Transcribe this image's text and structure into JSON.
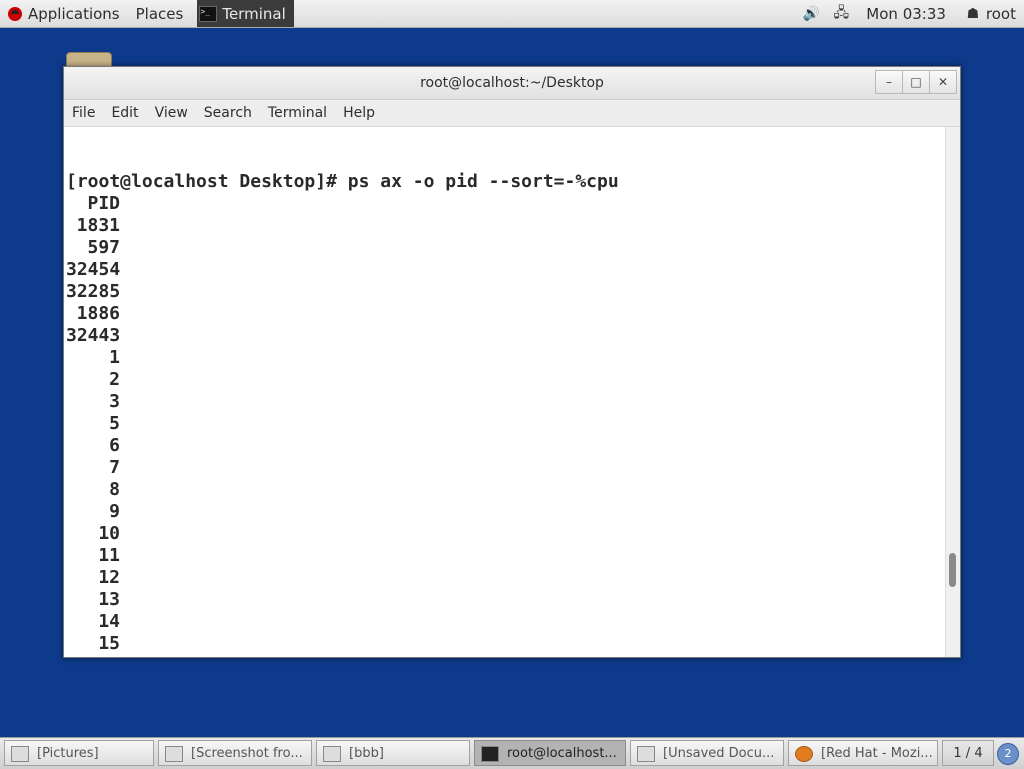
{
  "top_panel": {
    "applications": "Applications",
    "places": "Places",
    "active_app": "Terminal",
    "clock": "Mon 03:33",
    "user": "root"
  },
  "window": {
    "title": "root@localhost:~/Desktop",
    "menu": [
      "File",
      "Edit",
      "View",
      "Search",
      "Terminal",
      "Help"
    ]
  },
  "terminal": {
    "command_line": "[root@localhost Desktop]# ps ax -o pid --sort=-%cpu",
    "header": "PID",
    "pids": [
      "1831",
      "597",
      "32454",
      "32285",
      "1886",
      "32443",
      "1",
      "2",
      "3",
      "5",
      "6",
      "7",
      "8",
      "9",
      "10",
      "11",
      "12",
      "13",
      "14",
      "15"
    ]
  },
  "taskbar": {
    "tasks": [
      "[Pictures]",
      "[Screenshot fro...",
      "[bbb]",
      "root@localhost...",
      "[Unsaved Docu...",
      "[Red Hat - Mozi..."
    ],
    "pager": "1 / 4"
  }
}
